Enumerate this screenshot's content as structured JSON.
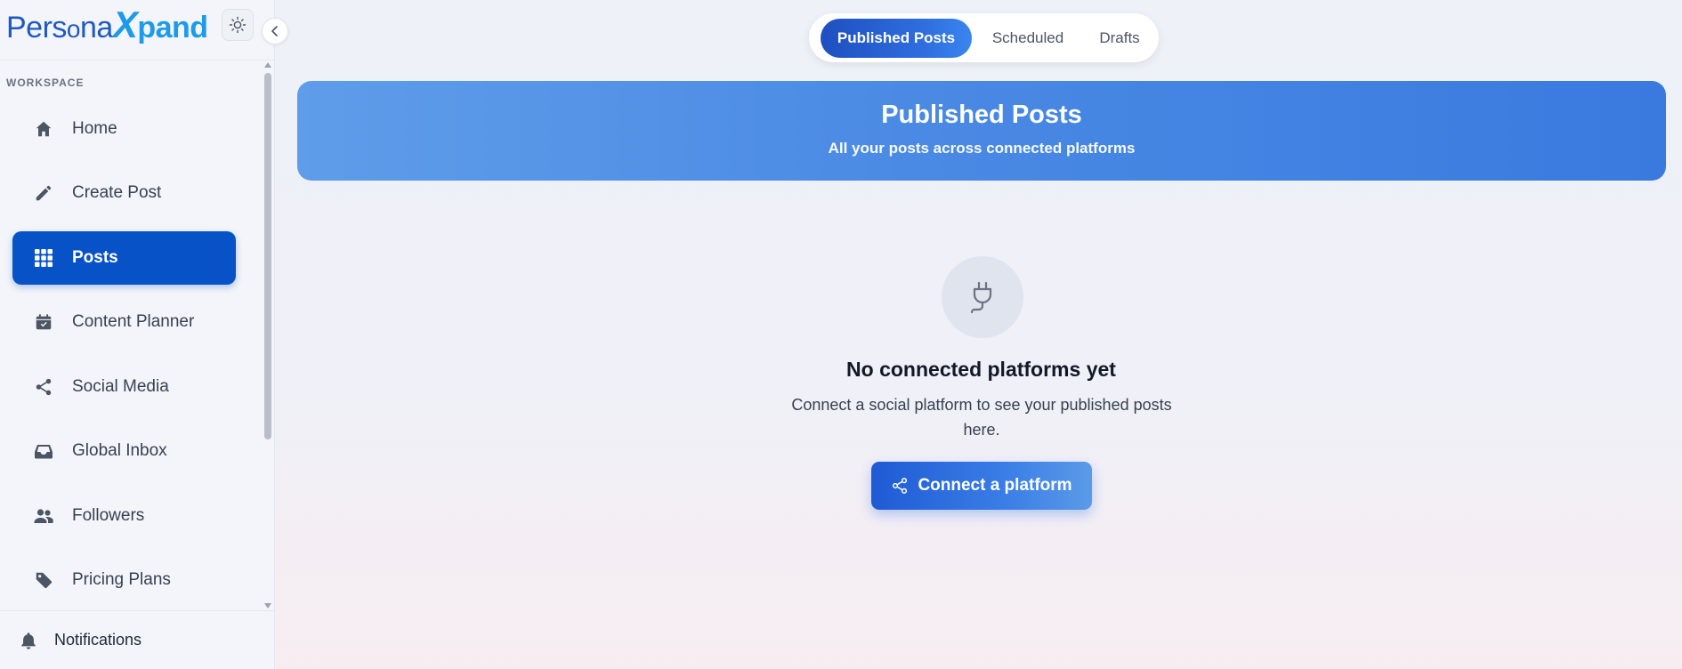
{
  "brand": {
    "logo_part1": "Pers",
    "logo_o": "o",
    "logo_part2": "na",
    "logo_x": "X",
    "logo_part3": "pand"
  },
  "sidebar": {
    "section_label": "WORKSPACE",
    "items": [
      {
        "label": "Home",
        "icon": "home-icon",
        "active": false
      },
      {
        "label": "Create Post",
        "icon": "pencil-icon",
        "active": false
      },
      {
        "label": "Posts",
        "icon": "grid-icon",
        "active": true
      },
      {
        "label": "Content Planner",
        "icon": "calendar-icon",
        "active": false
      },
      {
        "label": "Social Media",
        "icon": "share-icon",
        "active": false
      },
      {
        "label": "Global Inbox",
        "icon": "inbox-icon",
        "active": false
      },
      {
        "label": "Followers",
        "icon": "users-icon",
        "active": false
      },
      {
        "label": "Pricing Plans",
        "icon": "tag-icon",
        "active": false
      }
    ],
    "notifications_label": "Notifications"
  },
  "tabs": [
    {
      "label": "Published Posts",
      "active": true
    },
    {
      "label": "Scheduled",
      "active": false
    },
    {
      "label": "Drafts",
      "active": false
    }
  ],
  "banner": {
    "title": "Published Posts",
    "subtitle": "All your posts across connected platforms"
  },
  "empty_state": {
    "icon": "plug-icon",
    "title": "No connected platforms yet",
    "description": "Connect a social platform to see your published posts here.",
    "button_label": "Connect a platform"
  },
  "colors": {
    "accent": "#0852c8",
    "banner": "#4a8ae4",
    "logo_dark": "#1f5ac4",
    "logo_light": "#1d9bea"
  }
}
